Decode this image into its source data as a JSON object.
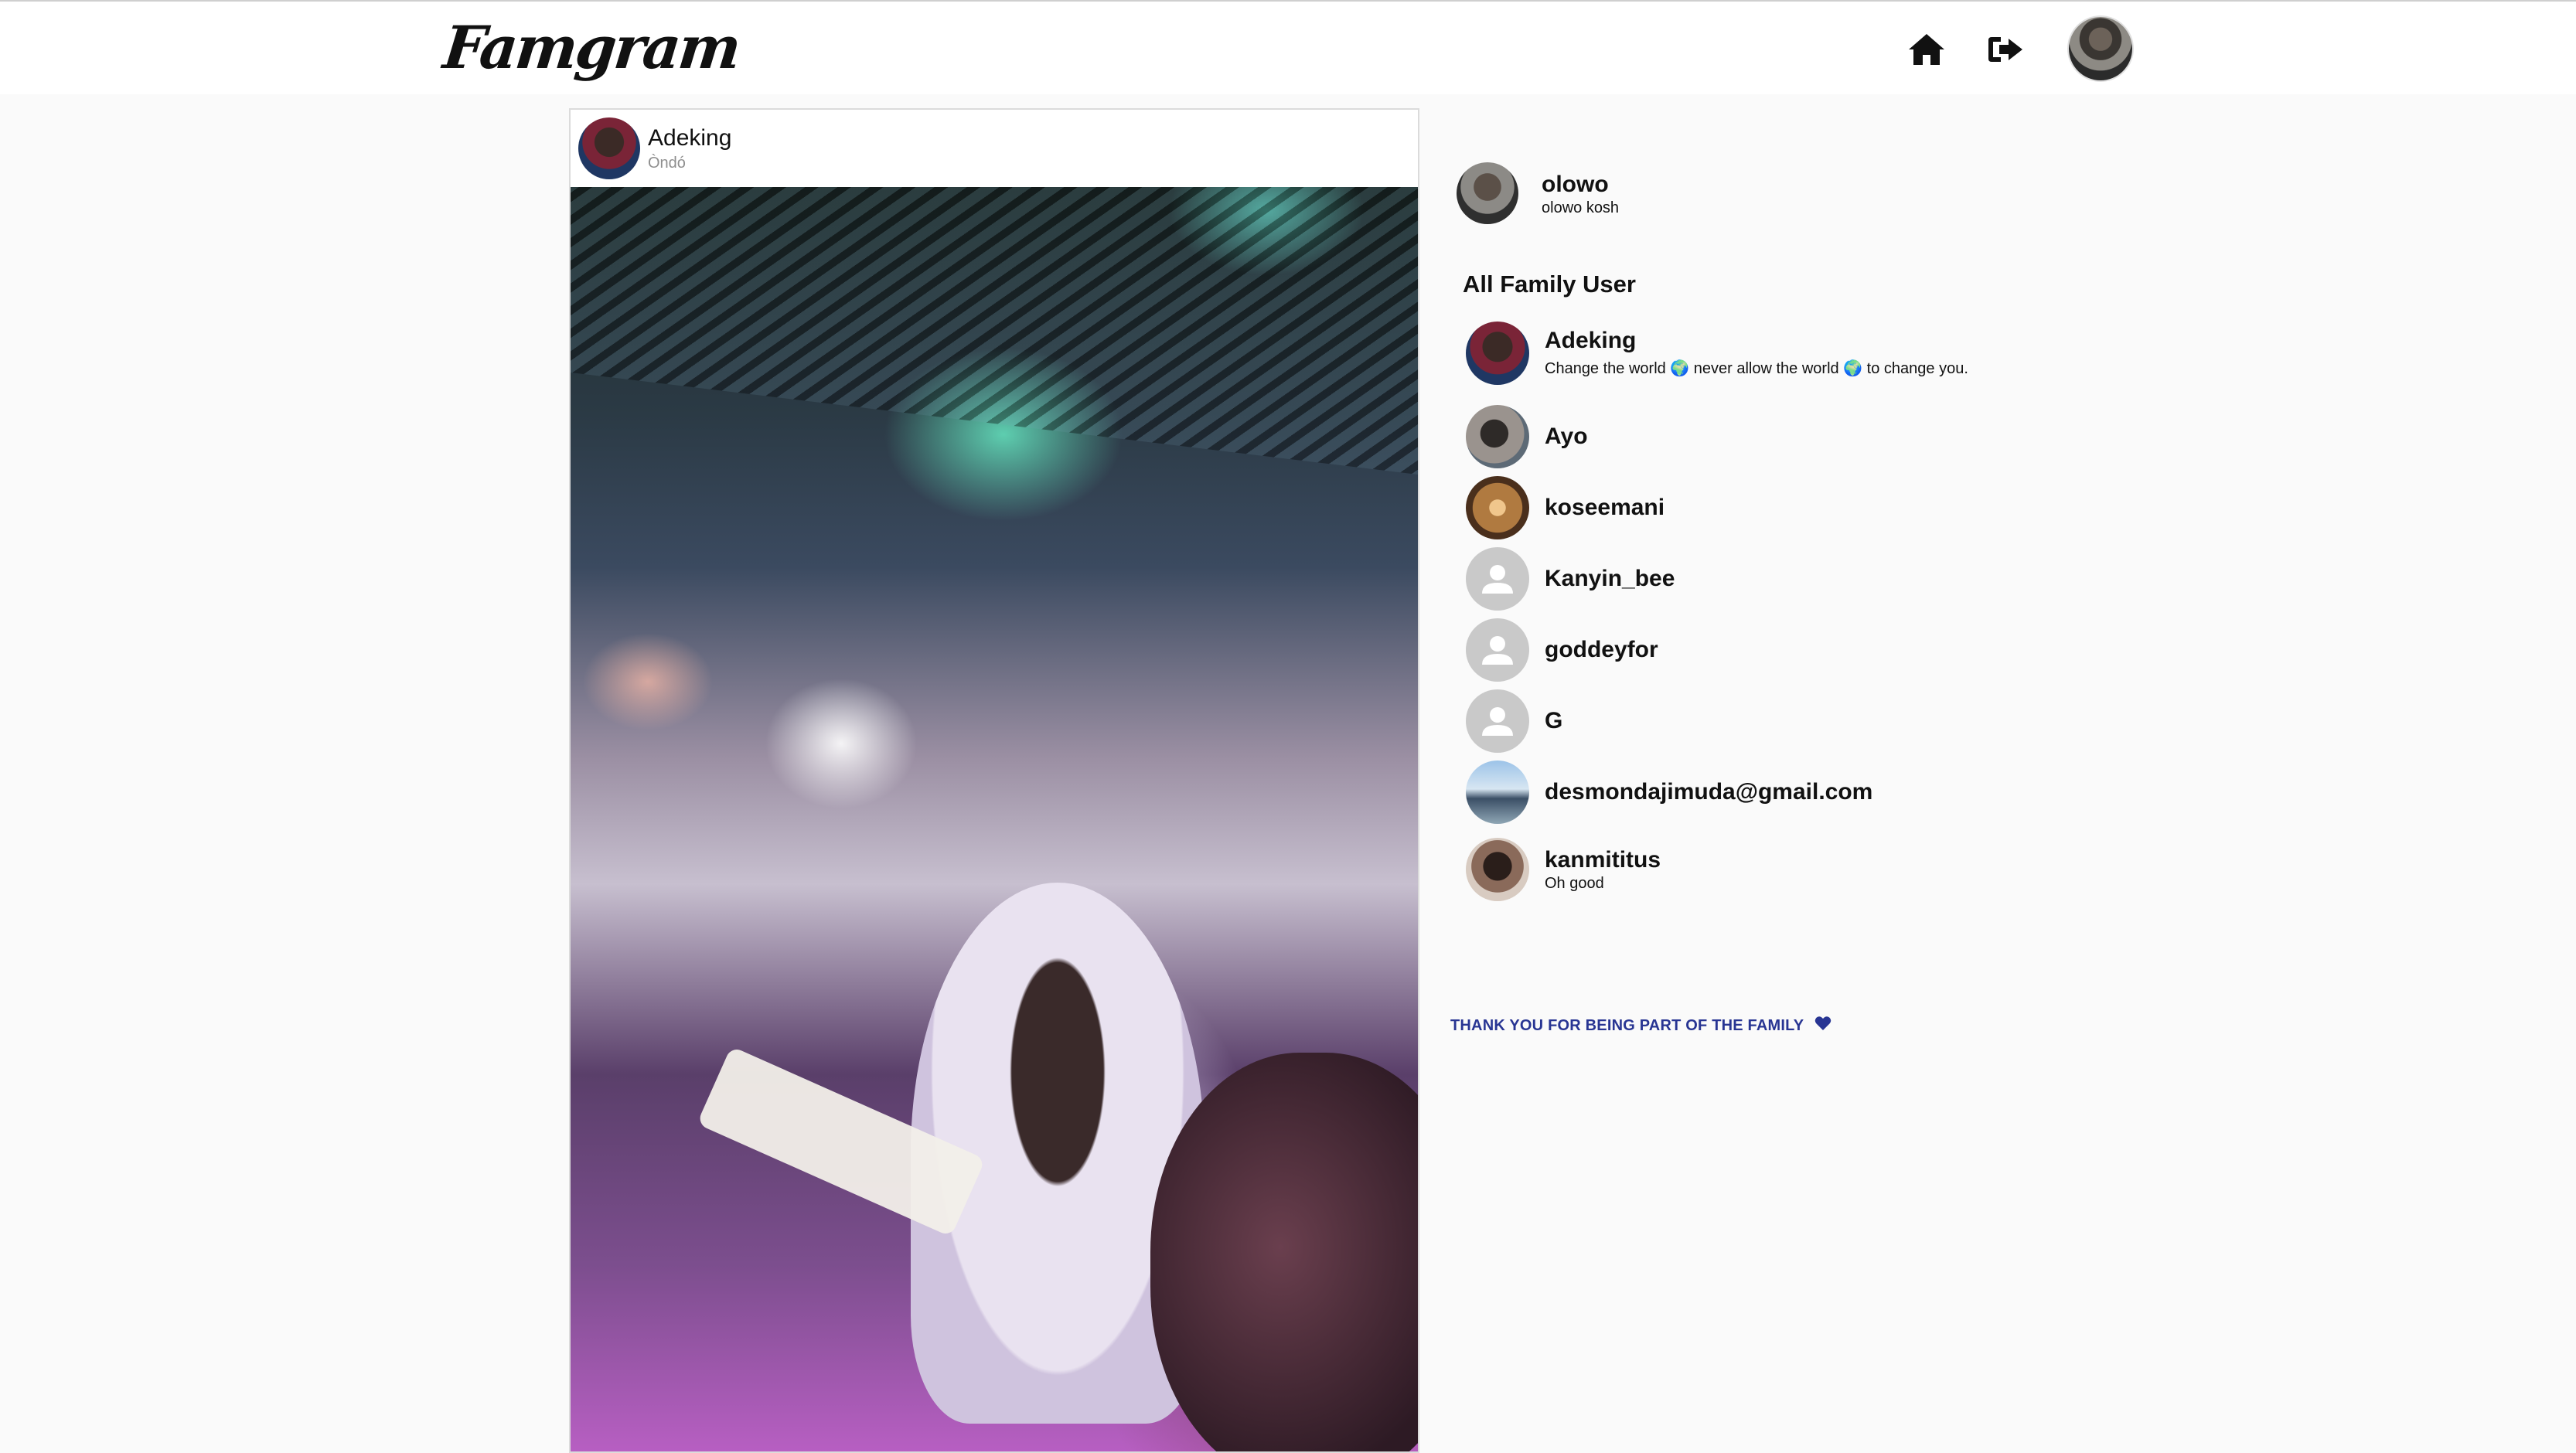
{
  "header": {
    "logo_text": "Famgram",
    "icons": [
      "home-icon",
      "logout-icon",
      "profile-avatar"
    ]
  },
  "post": {
    "username": "Adeking",
    "location": "Òndó",
    "image": "group selfie at night venue"
  },
  "current_user": {
    "username": "olowo",
    "full_name": "olowo kosh"
  },
  "family": {
    "title": "All Family User",
    "users": [
      {
        "name": "Adeking",
        "bio": "Change the world 🌍 never allow the world 🌍 to change you."
      },
      {
        "name": "Ayo",
        "bio": ""
      },
      {
        "name": "koseemani",
        "bio": ""
      },
      {
        "name": "Kanyin_bee",
        "bio": ""
      },
      {
        "name": "goddeyfor",
        "bio": ""
      },
      {
        "name": "G",
        "bio": ""
      },
      {
        "name": "desmondajimuda@gmail.com",
        "bio": ""
      },
      {
        "name": "kanmititus",
        "bio": "Oh good"
      }
    ]
  },
  "footer": {
    "message": "THANK YOU FOR BEING PART OF THE FAMILY",
    "icon": "heart-icon"
  },
  "colors": {
    "background": "#fafafa",
    "header": "#ffffff",
    "accent": "#283593",
    "card_border": "#dbdbdb"
  }
}
